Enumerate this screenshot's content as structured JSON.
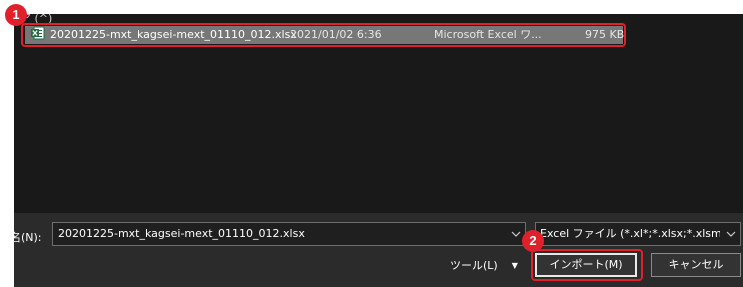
{
  "file_list": {
    "partial_header": "ア (^)",
    "selected_file": {
      "name": "20201225-mxt_kagsei-mext_01110_012.xlsx",
      "date": "2021/01/02 6:36",
      "type": "Microsoft Excel ワ...",
      "size": "975 KB",
      "icon": "excel-file-icon"
    }
  },
  "footer": {
    "filename_label": "名(N):",
    "filename_value": "20201225-mxt_kagsei-mext_01110_012.xlsx",
    "filetype_value": "Excel ファイル (*.xl*;*.xlsx;*.xlsm;*.xl",
    "tools_label": "ツール(L)",
    "import_label": "インポート(M)",
    "cancel_label": "キャンセル"
  },
  "annotations": {
    "marker_1": "1",
    "marker_2": "2",
    "highlight_color": "#e0202a"
  },
  "colors": {
    "list_background": "#191919",
    "dialog_background": "#2b2b2b",
    "selected_row": "#777777"
  }
}
